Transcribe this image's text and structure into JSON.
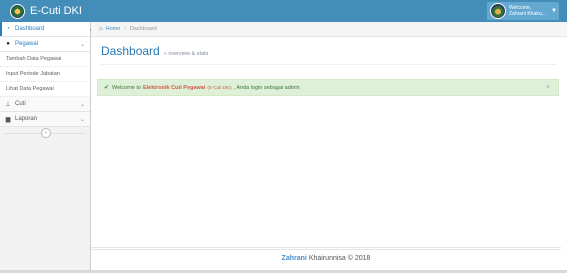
{
  "navbar": {
    "brand_title": "E-Cuti DKI",
    "user_greeting": "Welcome,",
    "user_name": "Zahrani Khairu...",
    "bg_color": "#438eb9"
  },
  "sidebar": {
    "items": [
      {
        "label": "Dashboard",
        "icon": "tachometer-icon",
        "active": true
      },
      {
        "label": "Pegawai",
        "icon": "user-icon",
        "open": true,
        "children": [
          "Tambah Data Pegawai",
          "Input Periode Jabatan",
          "Lihat Data Pegawai"
        ]
      },
      {
        "label": "Cuti",
        "icon": "thumb-tack-icon"
      },
      {
        "label": "Laporan",
        "icon": "file-icon"
      }
    ]
  },
  "breadcrumb": {
    "home": "Home",
    "current": "Dashboard"
  },
  "page_header": {
    "title": "Dashboard",
    "subtitle": "overview & stats"
  },
  "alert": {
    "prefix": "Welcome to",
    "app_name": "Elektronik Cuti Pegawai",
    "app_short": "(E-Cuti DKI)",
    "suffix": ", Anda login sebagai admin",
    "close_symbol": "×",
    "color": "#dff0d8"
  },
  "footer": {
    "name": "Zahrani",
    "rest": "Khairunnisa © 2018"
  }
}
